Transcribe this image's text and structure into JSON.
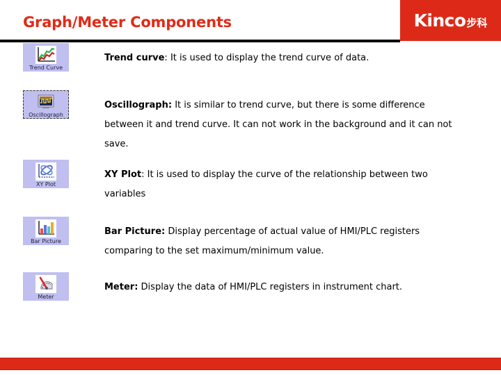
{
  "header": {
    "title": "Graph/Meter Components",
    "logo": {
      "latin": "Kinco",
      "cjk": "步科"
    },
    "title_color": "#e02b18",
    "logo_bg": "#dd2a18"
  },
  "footer": {
    "bar_color": "#dd2a18"
  },
  "items": [
    {
      "icon_name": "trend-curve-icon",
      "icon_label": "Trend Curve",
      "term": "Trend curve",
      "separator": ": ",
      "description": "It is used to display the trend curve of data."
    },
    {
      "icon_name": "oscillograph-icon",
      "icon_label": "Oscillograph",
      "term": "Oscillograph:",
      "separator": " ",
      "description": "It is similar to trend curve, but there is some difference between it and trend curve. It can not work in the background and it can not save."
    },
    {
      "icon_name": "xy-plot-icon",
      "icon_label": "XY Plot",
      "term": "XY Plot",
      "separator": ": ",
      "description": "It is used to display the curve of the relationship between two variables"
    },
    {
      "icon_name": "bar-picture-icon",
      "icon_label": "Bar Picture",
      "term": "Bar Picture:",
      "separator": " ",
      "description": "Display percentage of actual value of HMI/PLC registers comparing to the set maximum/minimum value."
    },
    {
      "icon_name": "meter-icon",
      "icon_label": "Meter",
      "term": "Meter:",
      "separator": " ",
      "description": "Display the data of HMI/PLC registers in instrument chart."
    }
  ]
}
